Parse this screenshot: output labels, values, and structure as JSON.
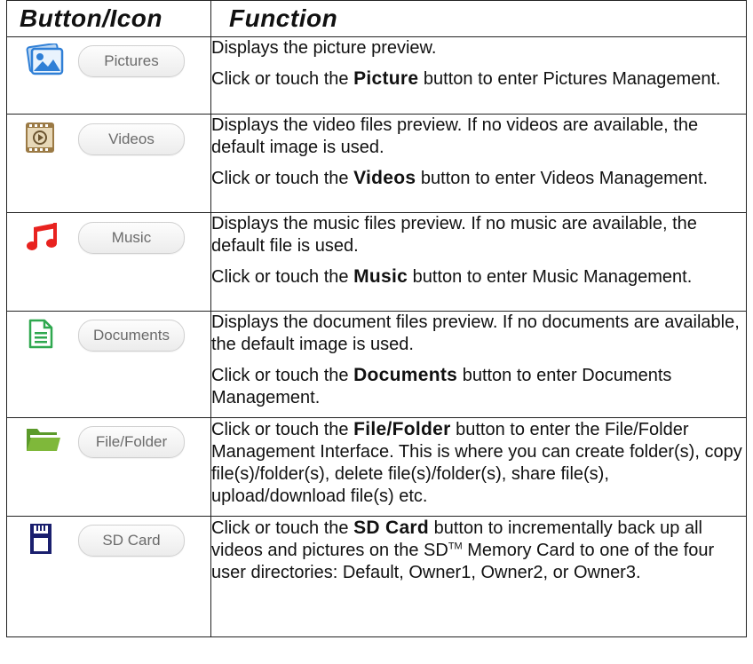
{
  "header": {
    "col1": "Button/Icon",
    "col2": "Function"
  },
  "rows": [
    {
      "button_label": "Pictures",
      "icon": "pictures-icon",
      "p1": "Displays the picture preview.",
      "p2_pre": "Click or touch the ",
      "p2_bold": "Picture",
      "p2_post": " button to enter Pictures Management."
    },
    {
      "button_label": "Videos",
      "icon": "videos-icon",
      "p1": "Displays the video files preview. If no videos are available, the default image is used.",
      "p2_pre": "Click or touch the ",
      "p2_bold": "Videos",
      "p2_post": " button to enter Videos Management."
    },
    {
      "button_label": "Music",
      "icon": "music-note-icon",
      "p1": "Displays the music files preview. If no music are available, the default file is used.",
      "p2_pre": "Click or touch the ",
      "p2_bold": "Music",
      "p2_post": " button to enter Music Management."
    },
    {
      "button_label": "Documents",
      "icon": "document-icon",
      "p1": "Displays the document files preview. If no documents are available, the default image is used.",
      "p2_pre": "Click or touch the ",
      "p2_bold": "Documents",
      "p2_post": " button to enter Documents Management."
    },
    {
      "button_label": "File/Folder",
      "icon": "folder-icon",
      "p1_pre": "Click or touch the ",
      "p1_bold": "File/Folder",
      "p1_post": " button to enter the File/Folder Management Interface. This is where you can create folder(s), copy file(s)/folder(s), delete file(s)/folder(s), share file(s), upload/download file(s) etc."
    },
    {
      "button_label": "SD Card",
      "icon": "sd-card-icon",
      "p1_pre": "Click or touch the ",
      "p1_bold": "SD Card",
      "p1_mid": " button to incrementally back up all videos and pictures on the SD",
      "p1_sup": "TM",
      "p1_post": " Memory Card to one of the four user directories: Default, Owner1, Owner2, or Owner3."
    }
  ],
  "colors": {
    "music_red": "#e8221f",
    "doc_green": "#2fa84f",
    "folder_green": "#7fb83a",
    "sd_navy": "#1a1f6e",
    "pictures_blue": "#2f7fd6",
    "videos_brown": "#9b7a45"
  }
}
